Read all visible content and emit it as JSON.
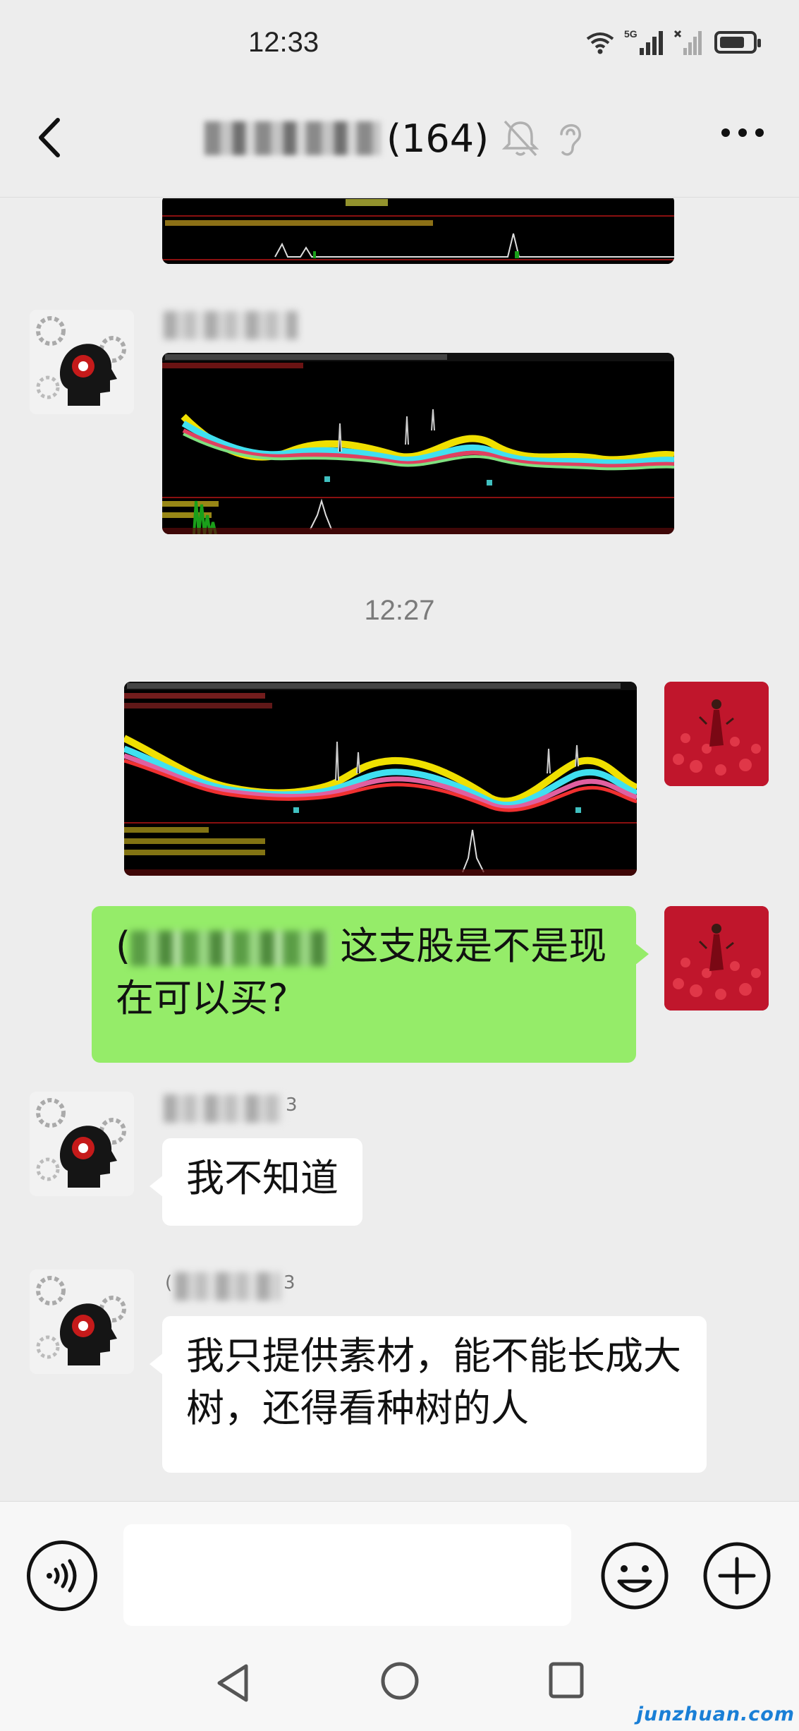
{
  "status_bar": {
    "time": "12:33",
    "network": "5G"
  },
  "header": {
    "member_count": "(164)"
  },
  "timestamp": "12:27",
  "messages": {
    "sent_text_before": "(",
    "sent_text_after": " 这支股是不是现在可以买?",
    "reply1_sender_suffix": "3",
    "reply1_text": "我不知道",
    "reply2_sender_prefix": "(",
    "reply2_sender_suffix": "3",
    "reply2_text": "我只提供素材，能不能长成大树，还得看种树的人"
  },
  "icons": {
    "back": "chevron-left-icon",
    "mute": "bell-off-icon",
    "ear": "ear-icon",
    "more": "more-dots-icon",
    "voice": "voice-icon",
    "emoji": "emoji-icon",
    "plus": "plus-icon"
  },
  "watermark": "junzhuan.com"
}
